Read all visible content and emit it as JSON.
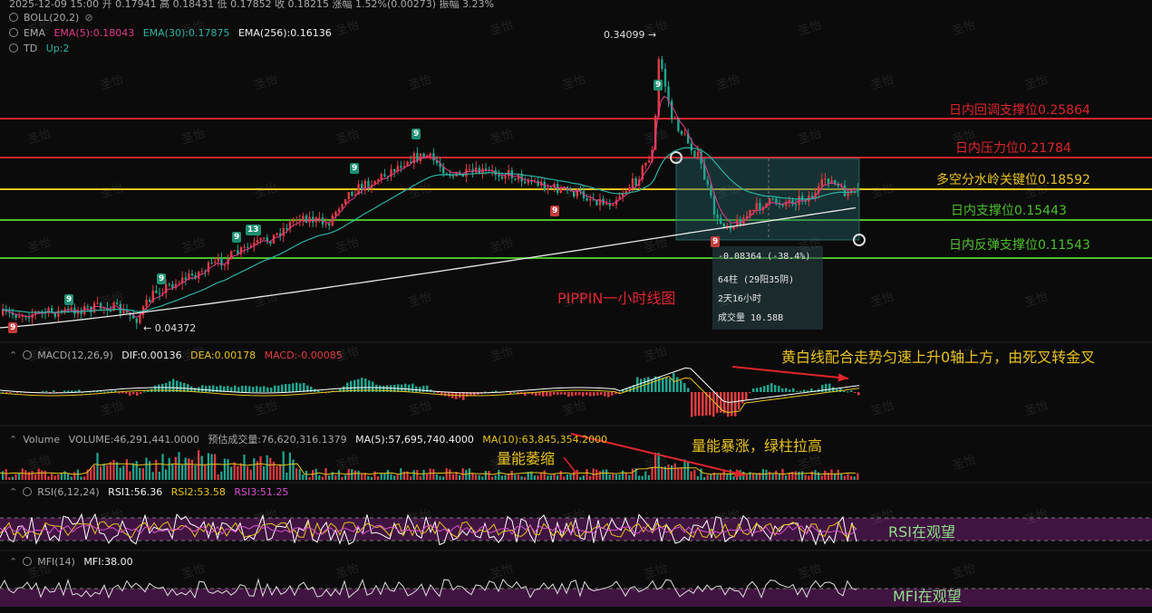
{
  "header": {
    "date_line": "2025-12-09 15:00  开 0.17941  高 0.18431  低 0.17852  收 0.18215  涨幅 1.52%(0.00273)  振幅 3.23%",
    "boll_label": "BOLL(20,2)",
    "ema_label": "EMA",
    "ema5": "EMA(5):0.18043",
    "ema30": "EMA(30):0.17875",
    "ema256": "EMA(256):0.16136",
    "td_label": "TD",
    "td_value": "Up:2"
  },
  "price_labels": {
    "high": "0.34099",
    "low": "0.04372"
  },
  "levels": [
    {
      "text": "日内回调支撑位0.25864",
      "color": "#e0242c"
    },
    {
      "text": "日内压力位0.21784",
      "color": "#e0242c"
    },
    {
      "text": "多空分水岭关键位0.18592",
      "color": "#e8c21c"
    },
    {
      "text": "日内支撑位0.15443",
      "color": "#4cbf2a"
    },
    {
      "text": "日内反弹支撑位0.11543",
      "color": "#4cbf2a"
    }
  ],
  "chart_title": "PIPPIN一小时线图",
  "measure": {
    "change": "-0.08364 (-38.4%)",
    "bars": "64柱 (29阳35阴)",
    "duration": "2天16小时",
    "volume": "成交量 10.58B"
  },
  "td_badges": [
    "9",
    "9",
    "9",
    "9",
    "13",
    "9",
    "9",
    "9",
    "9",
    "9"
  ],
  "macd": {
    "label": "MACD(12,26,9)",
    "dif": "DIF:0.00136",
    "dea": "DEA:0.00178",
    "macd": "MACD:-0.00085",
    "note": "黄白线配合走势匀速上升0轴上方，由死叉转金叉"
  },
  "volume": {
    "label": "Volume",
    "vol": "VOLUME:46,291,441.0000",
    "est": "预估成交量:76,620,316.1379",
    "ma5": "MA(5):57,695,740.4000",
    "ma10": "MA(10):63,845,354.2000",
    "note_shrink": "量能萎缩",
    "note_surge": "量能暴涨，绿柱拉高"
  },
  "rsi": {
    "label": "RSI(6,12,24)",
    "rsi1": "RSI1:56.36",
    "rsi2": "RSI2:53.58",
    "rsi3": "RSI3:51.25",
    "note": "RSI在观望"
  },
  "mfi": {
    "label": "MFI(14)",
    "mfi": "MFI:38.00",
    "note": "MFI在观望"
  },
  "watermark": "圣怡",
  "colors": {
    "up": "#e23b40",
    "down": "#1fa68f",
    "ema5": "#e23b8a",
    "ema30": "#2bb3a4",
    "ema256": "#e8e8e8",
    "dif": "#ffffff",
    "dea": "#e8c21c"
  }
}
